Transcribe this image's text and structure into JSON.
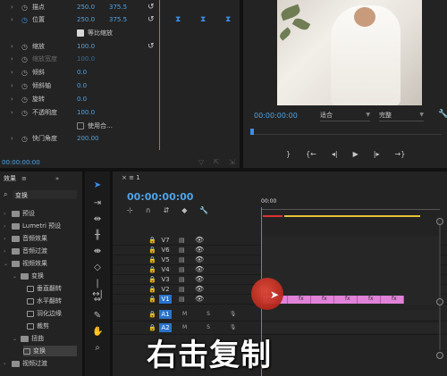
{
  "effect_controls": {
    "rows": [
      {
        "name": "描点",
        "v1": "250.0",
        "v2": "375.5"
      },
      {
        "name": "位置",
        "v1": "250.0",
        "v2": "375.5"
      },
      {
        "name": "等比缩放",
        "checkbox": true
      },
      {
        "name": "缩放",
        "v1": "100.0"
      },
      {
        "name": "缩放宽度",
        "v1": "100.0"
      },
      {
        "name": "倾斜",
        "v1": "0.0"
      },
      {
        "name": "倾斜轴",
        "v1": "0.0"
      },
      {
        "name": "旋转",
        "v1": "0.0"
      },
      {
        "name": "不透明度",
        "v1": "100.0"
      },
      {
        "name": "使用合…",
        "checkbox": false
      },
      {
        "name": "快门角度",
        "v1": "200.00"
      }
    ],
    "timecode": "00:00:00:00"
  },
  "program_monitor": {
    "timecode": "00:00:00:00",
    "zoom": "适合",
    "quality": "完整"
  },
  "effects_panel": {
    "tab_label": "效果",
    "search_value": "变换",
    "tree": [
      {
        "label": "预设",
        "level": 0
      },
      {
        "label": "Lumetri 预设",
        "level": 0
      },
      {
        "label": "音频效果",
        "level": 0
      },
      {
        "label": "音频过渡",
        "level": 0
      },
      {
        "label": "视频效果",
        "level": 0
      },
      {
        "label": "变换",
        "level": 1
      },
      {
        "label": "垂直翻转",
        "level": 2
      },
      {
        "label": "水平翻转",
        "level": 2
      },
      {
        "label": "羽化边缘",
        "level": 2
      },
      {
        "label": "裁剪",
        "level": 2
      },
      {
        "label": "扭曲",
        "level": 1
      },
      {
        "label": "变换",
        "level": 2
      },
      {
        "label": "视频过渡",
        "level": 0
      }
    ]
  },
  "timeline": {
    "tab_label": "1",
    "timecode": "00:00:00:00",
    "ruler_timecode": "00:00",
    "video_tracks": [
      "V7",
      "V6",
      "V5",
      "V4",
      "V3",
      "V2",
      "V1"
    ],
    "audio_tracks": [
      "A1",
      "A2"
    ],
    "clip_label": "fx",
    "clip_count": 6
  },
  "caption": "右击复制",
  "colors": {
    "accent": "#3a8ee8",
    "clip": "#e082d8",
    "work_area": "#e4c23a",
    "cursor_circle": "#c8352a"
  }
}
